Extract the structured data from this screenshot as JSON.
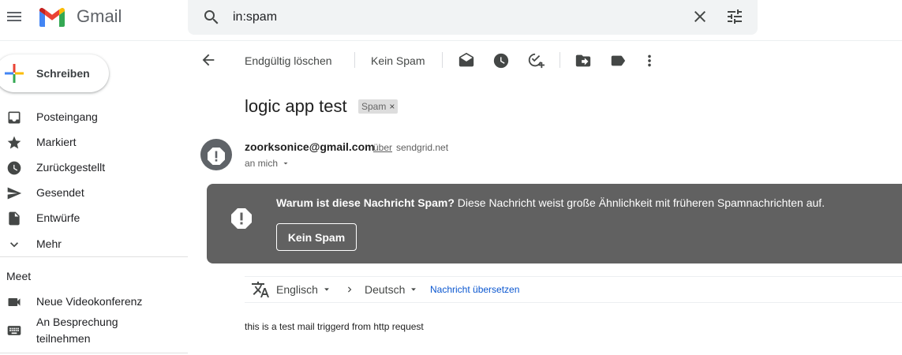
{
  "header": {
    "brand": "Gmail",
    "search_value": "in:spam",
    "icons": [
      "menu-icon",
      "gmail-logo",
      "search-icon",
      "close-icon",
      "tune-icon"
    ]
  },
  "sidebar": {
    "compose_label": "Schreiben",
    "items": [
      {
        "label": "Posteingang",
        "icon": "inbox-icon"
      },
      {
        "label": "Markiert",
        "icon": "star-icon"
      },
      {
        "label": "Zurückgestellt",
        "icon": "clock-icon"
      },
      {
        "label": "Gesendet",
        "icon": "send-icon"
      },
      {
        "label": "Entwürfe",
        "icon": "draft-icon"
      },
      {
        "label": "Mehr",
        "icon": "chevron-down-icon"
      }
    ],
    "meet": {
      "title": "Meet",
      "items": [
        {
          "label": "Neue Videokonferenz",
          "icon": "videocam-icon"
        },
        {
          "label_line1": "An Besprechung",
          "label_line2": "teilnehmen",
          "icon": "keyboard-icon"
        }
      ]
    }
  },
  "toolbar": {
    "delete_forever_label": "Endgültig löschen",
    "not_spam_label": "Kein Spam"
  },
  "message": {
    "subject": "logic app test",
    "label_chip": "Spam",
    "sender_email": "zoorksonice@gmail.com",
    "via_label": "über",
    "via_domain": "sendgrid.net",
    "recipient": "an mich",
    "spam_banner": {
      "title": "Warum ist diese Nachricht Spam?",
      "text": "Diese Nachricht weist große Ähnlichkeit mit früheren Spamnachrichten auf.",
      "button": "Kein Spam"
    },
    "translate": {
      "source_lang": "Englisch",
      "target_lang": "Deutsch",
      "link": "Nachricht übersetzen"
    },
    "body": "this is a test mail triggerd from http request"
  },
  "colors": {
    "banner_bg": "#616161",
    "link_blue": "#0b57d0",
    "icon_grey": "#5f6368",
    "search_bg": "#f1f3f4"
  }
}
